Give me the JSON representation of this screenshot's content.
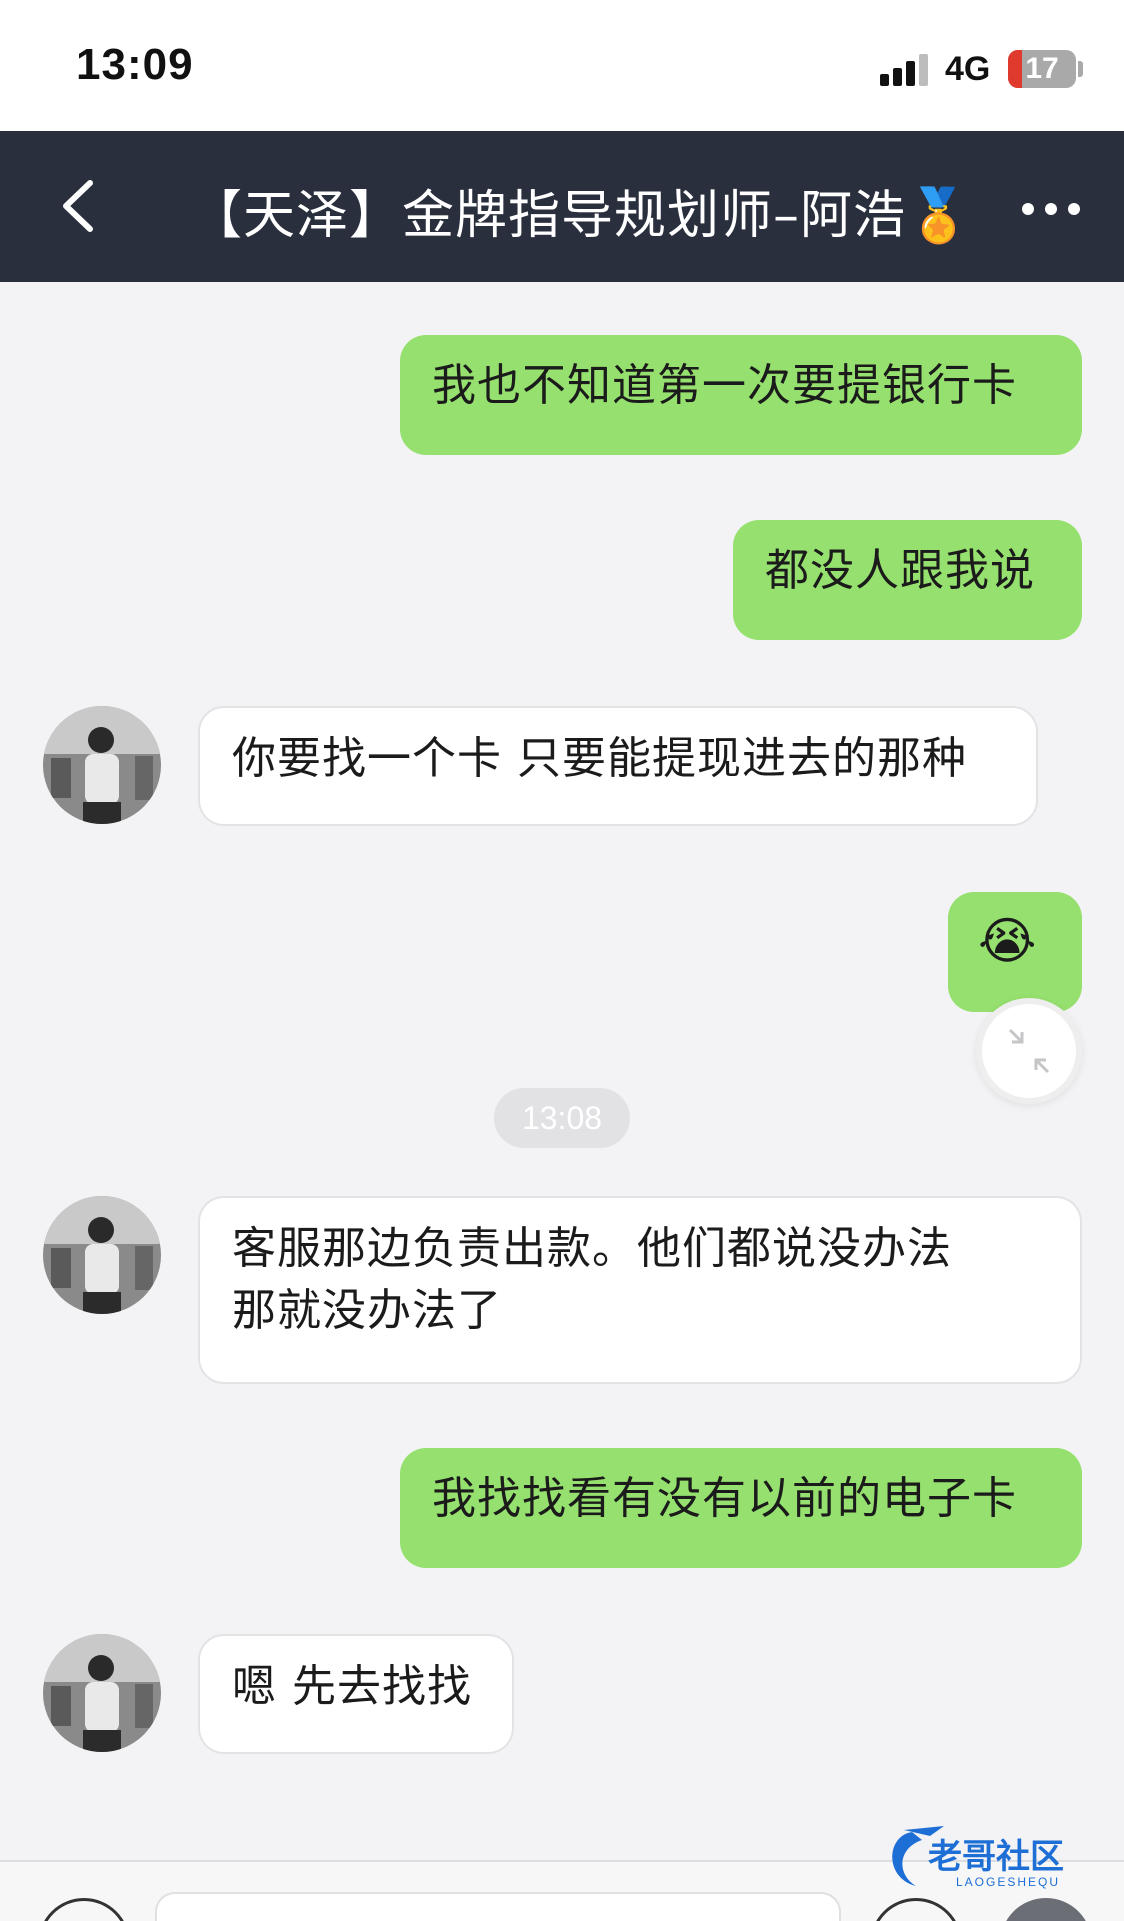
{
  "status_bar": {
    "time": "13:09",
    "network": "4G",
    "battery": "17",
    "battery_level_percent": 17
  },
  "header": {
    "title": "【天泽】金牌指导规划师–阿浩🏅",
    "back_icon": "chevron-left-icon",
    "more_icon": "more-dots-icon"
  },
  "messages": [
    {
      "side": "out",
      "text": "我也不知道第一次要提银行卡"
    },
    {
      "side": "out",
      "text": "都没人跟我说"
    },
    {
      "side": "in",
      "text": "你要找一个卡 只要能提现进去的那种"
    },
    {
      "side": "out",
      "text": "😭"
    },
    {
      "side": "in",
      "text_line1": "客服那边负责出款。他们都说没办法",
      "text_line2": "那就没办法了"
    },
    {
      "side": "out",
      "text": "我找找看有没有以前的电子卡"
    },
    {
      "side": "in",
      "text": "嗯 先去找找"
    }
  ],
  "time_divider": "13:08",
  "watermark": {
    "name": "老哥社区",
    "sub": "LAOGESHEQU"
  },
  "colors": {
    "header_bg": "#2a2f3e",
    "outgoing_bubble": "#95e06e",
    "incoming_bubble": "#ffffff",
    "page_bg": "#f3f3f5"
  }
}
